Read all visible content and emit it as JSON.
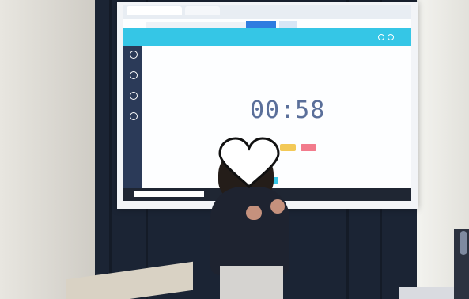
{
  "screen": {
    "timer": "00:58"
  }
}
